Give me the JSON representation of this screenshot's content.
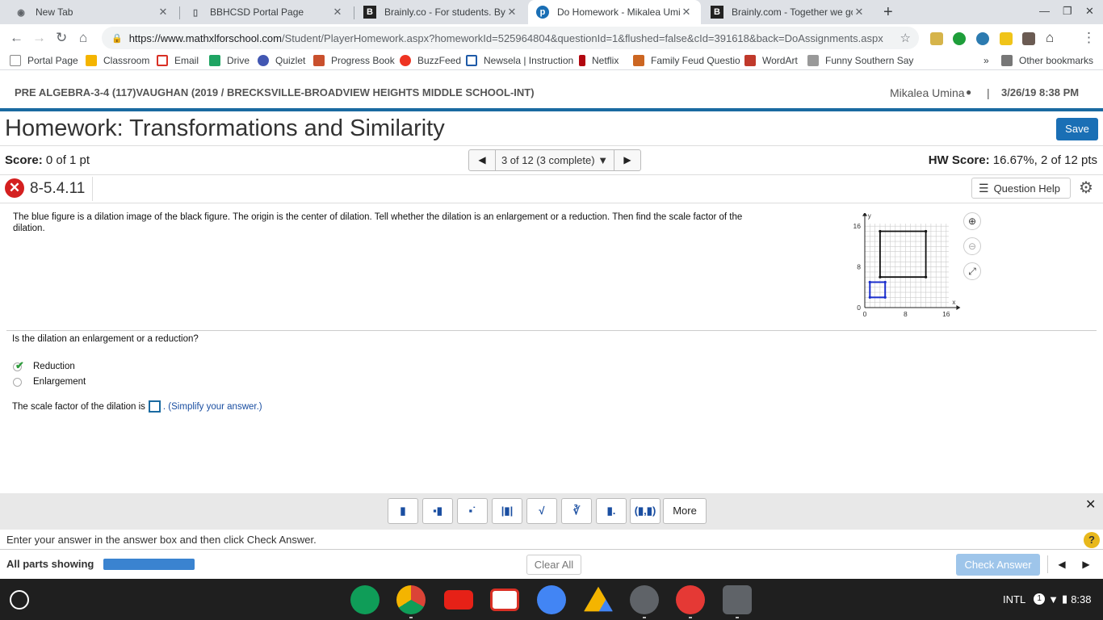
{
  "browser": {
    "tabs": [
      {
        "title": "New Tab",
        "icon": "chrome-icon"
      },
      {
        "title": "BBHCSD Portal Page",
        "icon": "page-icon"
      },
      {
        "title": "Brainly.co - For students. By stu",
        "icon": "brainly-icon"
      },
      {
        "title": "Do Homework - Mikalea Umina",
        "icon": "pearson-icon"
      },
      {
        "title": "Brainly.com - Together we go far",
        "icon": "brainly-icon"
      }
    ],
    "active_tab": 3,
    "url_host": "https://www.mathxlforschool.com",
    "url_path": "/Student/PlayerHomework.aspx?homeworkId=525964804&questionId=1&flushed=false&cId=391618&back=DoAssignments.aspx",
    "bookmarks": [
      "Portal Page",
      "Classroom",
      "Email",
      "Drive",
      "Quizlet",
      "Progress Book",
      "BuzzFeed",
      "Newsela | Instruction",
      "Netflix",
      "Family Feud Questio",
      "WordArt",
      "Funny Southern Say"
    ],
    "bookmark_overflow": "»",
    "other_bookmarks": "Other bookmarks"
  },
  "header": {
    "course": "PRE ALGEBRA-3-4 (117)VAUGHAN (2019 / BRECKSVILLE-BROADVIEW HEIGHTS MIDDLE SCHOOL-INT)",
    "user": "Mikalea Umina",
    "separator": "|",
    "datetime": "3/26/19 8:38 PM"
  },
  "homework": {
    "title": "Homework: Transformations and Similarity",
    "save_label": "Save",
    "score_label": "Score:",
    "score_value": "0 of 1 pt",
    "question_nav": "3 of 12 (3 complete)",
    "hw_score_label": "HW Score:",
    "hw_score_value": "16.67%, 2 of 12 pts",
    "question_id": "8-5.4.11",
    "question_help": "Question Help"
  },
  "question": {
    "prompt": "The blue figure is a dilation image of the black figure. The origin is the center of dilation. Tell whether the dilation is an enlargement or a reduction. Then find the scale factor of the dilation.",
    "part1": "Is the dilation an enlargement or a reduction?",
    "options": [
      {
        "label": "Reduction",
        "selected": true
      },
      {
        "label": "Enlargement",
        "selected": false
      }
    ],
    "scale_prefix": "The scale factor of the dilation is",
    "scale_suffix": ". (Simplify your answer.)"
  },
  "graph": {
    "axis_x_label": "x",
    "axis_y_label": "y",
    "x_ticks": [
      "0",
      "8",
      "16"
    ],
    "y_ticks": [
      "0",
      "8",
      "16"
    ],
    "black_square": [
      [
        3,
        6
      ],
      [
        12,
        6
      ],
      [
        12,
        15
      ],
      [
        3,
        15
      ]
    ],
    "blue_square": [
      [
        1,
        2
      ],
      [
        4,
        2
      ],
      [
        4,
        5
      ],
      [
        1,
        5
      ]
    ],
    "black_color": "#111111",
    "blue_color": "#1a2ecc"
  },
  "palette": {
    "more_label": "More"
  },
  "footer": {
    "instruction": "Enter your answer in the answer box and then click Check Answer.",
    "all_parts": "All parts showing",
    "progress": 1.0,
    "clear_all": "Clear All",
    "check_answer": "Check Answer"
  },
  "taskbar": {
    "keyboard": "INTL",
    "notification_count": "1",
    "time": "8:38"
  }
}
